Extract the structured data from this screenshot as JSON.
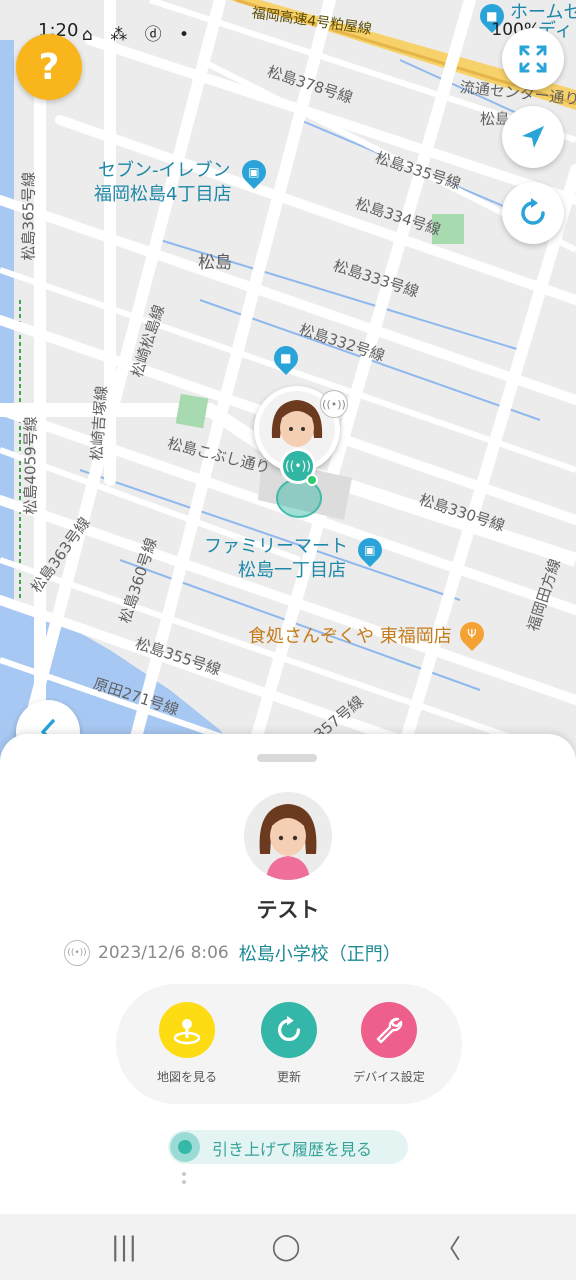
{
  "status_bar": {
    "time": "1:20",
    "left_icons": "⌂ ⁂ ⓓ •",
    "right_icons": "◐ ✕ ◉ ☰ ▮▮",
    "battery": "100%"
  },
  "map": {
    "labels": {
      "highway": "福岡高速4号粕屋線",
      "r378": "松島378号線",
      "r335": "松島335号線",
      "r334": "松島334号線",
      "r333": "松島333号線",
      "r332": "松島332号線",
      "r365": "松島365号線",
      "matsuzaki": "松崎松島線",
      "matsuzaki2": "松崎吉塚線",
      "r4059": "松島4059号線",
      "kobushi": "松島こぶし通り",
      "r330": "松島330号線",
      "r363": "松島363号線",
      "r360": "松島360号線",
      "r355": "松島355号線",
      "harada": "原田271号線",
      "r357": "357号線",
      "ryutsu": "流通センター通り",
      "fukuoka_tagata": "福岡田方線",
      "top_partial": "松島",
      "homecenter": "ホームセ",
      "homecenter2": "ディ"
    },
    "area_name": "松島",
    "pois": {
      "seven_line1": "セブン-イレブン",
      "seven_line2": "福岡松島4丁目店",
      "family_line1": "ファミリーマート",
      "family_line2": "松島一丁目店",
      "restaurant": "食処さんぞくや 東福岡店"
    },
    "help_label": "?",
    "colors": {
      "help": "#f9b51c",
      "accent_blue": "#2aa4d8",
      "teal": "#30b6a3"
    }
  },
  "sheet": {
    "child_name": "テスト",
    "datetime": "2023/12/6 8:06",
    "place": "松島小学校（正門）",
    "actions": {
      "map": "地図を見る",
      "refresh": "更新",
      "settings": "デバイス設定"
    },
    "history_label": "引き上げて履歴を見る"
  },
  "navbar": {
    "recents": "|||",
    "home": "◯",
    "back": "〈"
  }
}
